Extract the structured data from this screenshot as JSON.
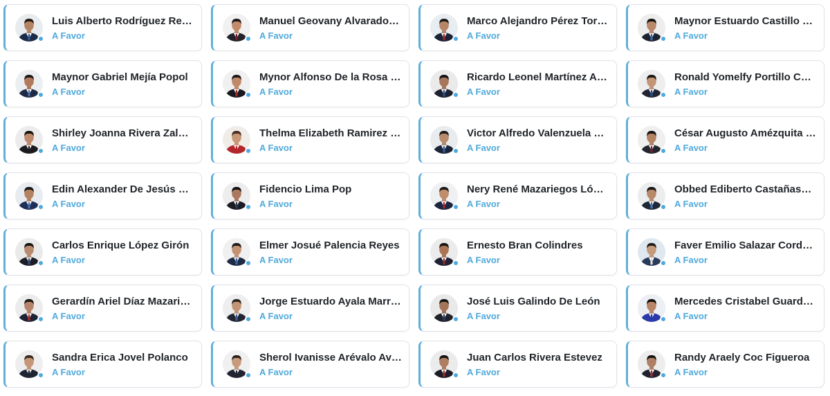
{
  "colors": {
    "accent": "#5fb0d6",
    "vote_text": "#4fa9dc",
    "status_dot": "#4ea9dc",
    "name_text": "#1f2328"
  },
  "cards": [
    {
      "name": "Luis Alberto Rodríguez Reyes",
      "vote": "A Favor",
      "avatar_icon": "person-avatar-icon",
      "suit": "#1d2b46",
      "tie": "#2c5aa0",
      "skin": "#b58463",
      "hair": "#231b16",
      "bg": "#e9ecef"
    },
    {
      "name": "Manuel Geovany Alvarado …",
      "vote": "A Favor",
      "avatar_icon": "person-avatar-icon",
      "suit": "#22232b",
      "tie": "#7a1f27",
      "skin": "#c28c6c",
      "hair": "#1e1a18",
      "bg": "#f1f1f1"
    },
    {
      "name": "Marco Alejandro Pérez Tori…",
      "vote": "A Favor",
      "avatar_icon": "person-avatar-icon",
      "suit": "#1b2436",
      "tie": "#9b2530",
      "skin": "#b78667",
      "hair": "#1c1a19",
      "bg": "#e8edf2"
    },
    {
      "name": "Maynor Estuardo Castillo y …",
      "vote": "A Favor",
      "avatar_icon": "person-avatar-icon",
      "suit": "#1e2330",
      "tie": "#3b6ea8",
      "skin": "#b9886a",
      "hair": "#151312",
      "bg": "#ededed"
    },
    {
      "name": "Maynor Gabriel Mejía Popol",
      "vote": "A Favor",
      "avatar_icon": "person-avatar-icon",
      "suit": "#1e2a44",
      "tie": "#4a6fa5",
      "skin": "#b07a5b",
      "hair": "#201a16",
      "bg": "#eceff2"
    },
    {
      "name": "Mynor Alfonso De la Rosa …",
      "vote": "A Favor",
      "avatar_icon": "person-avatar-icon",
      "suit": "#18191f",
      "tie": "#a02a2a",
      "skin": "#c08a6a",
      "hair": "#1b1817",
      "bg": "#f0f0f0"
    },
    {
      "name": "Ricardo Leonel Martínez Al…",
      "vote": "A Favor",
      "avatar_icon": "person-avatar-icon",
      "suit": "#1d2230",
      "tie": "#2d4f86",
      "skin": "#a8765a",
      "hair": "#141212",
      "bg": "#eaeaea"
    },
    {
      "name": "Ronald Yomelfy Portillo Cor…",
      "vote": "A Favor",
      "avatar_icon": "person-avatar-icon",
      "suit": "#202534",
      "tie": "#274f8c",
      "skin": "#c39475",
      "hair": "#1a1715",
      "bg": "#eeeeee"
    },
    {
      "name": "Shirley Joanna Rivera Zald…",
      "vote": "A Favor",
      "avatar_icon": "person-avatar-icon",
      "suit": "#1a1a1f",
      "tie": "#1a1a1f",
      "skin": "#bf8a6c",
      "hair": "#17120f",
      "bg": "#ececec"
    },
    {
      "name": "Thelma Elizabeth Ramirez …",
      "vote": "A Favor",
      "avatar_icon": "person-avatar-icon",
      "suit": "#b3262c",
      "tie": "#b3262c",
      "skin": "#c99676",
      "hair": "#4a2f22",
      "bg": "#f0ede9"
    },
    {
      "name": "Victor Alfredo Valenzuela …",
      "vote": "A Favor",
      "avatar_icon": "person-avatar-icon",
      "suit": "#1c2538",
      "tie": "#305b99",
      "skin": "#b98b6d",
      "hair": "#1f1b18",
      "bg": "#e9ecef"
    },
    {
      "name": "César Augusto Amézquita …",
      "vote": "A Favor",
      "avatar_icon": "person-avatar-icon",
      "suit": "#22252e",
      "tie": "#7a2330",
      "skin": "#b38363",
      "hair": "#161413",
      "bg": "#efefef"
    },
    {
      "name": "Edin Alexander De Jesús M…",
      "vote": "A Favor",
      "avatar_icon": "person-avatar-icon",
      "suit": "#1f2f55",
      "tie": "#4370b4",
      "skin": "#b5825f",
      "hair": "#1a1715",
      "bg": "#e8ecf1"
    },
    {
      "name": "Fidencio Lima Pop",
      "vote": "A Favor",
      "avatar_icon": "person-avatar-icon",
      "suit": "#1b1d24",
      "tie": "#2f3a55",
      "skin": "#ab7a5e",
      "hair": "#121111",
      "bg": "#ededed"
    },
    {
      "name": "Nery René Mazariegos López",
      "vote": "A Favor",
      "avatar_icon": "person-avatar-icon",
      "suit": "#1b2540",
      "tie": "#a3242c",
      "skin": "#c08c6b",
      "hair": "#1c1917",
      "bg": "#eef0f2"
    },
    {
      "name": "Obbed Ediberto Castañasa …",
      "vote": "A Favor",
      "avatar_icon": "person-avatar-icon",
      "suit": "#1d2738",
      "tie": "#4672b3",
      "skin": "#b8896b",
      "hair": "#1a1716",
      "bg": "#ecedef"
    },
    {
      "name": "Carlos Enrique López Girón",
      "vote": "A Favor",
      "avatar_icon": "person-avatar-icon",
      "suit": "#1c1e25",
      "tie": "#2e4d7d",
      "skin": "#b88b6e",
      "hair": "#161413",
      "bg": "#eaeaea"
    },
    {
      "name": "Elmer Josué Palencia Reyes",
      "vote": "A Favor",
      "avatar_icon": "person-avatar-icon",
      "suit": "#1f2a44",
      "tie": "#3c66a3",
      "skin": "#c29272",
      "hair": "#1d1a18",
      "bg": "#f0f0f0"
    },
    {
      "name": "Ernesto Bran Colindres",
      "vote": "A Favor",
      "avatar_icon": "person-avatar-icon",
      "suit": "#1e2232",
      "tie": "#8c2a2e",
      "skin": "#aa7455",
      "hair": "#181513",
      "bg": "#ebebeb"
    },
    {
      "name": "Faver Emilio Salazar Cordero",
      "vote": "A Favor",
      "avatar_icon": "person-avatar-icon",
      "suit": "#2a3b5a",
      "tie": "#d9d9d9",
      "skin": "#c79a7b",
      "hair": "#201c1a",
      "bg": "#dfe8ef"
    },
    {
      "name": "Gerardín Ariel Díaz Mazarie…",
      "vote": "A Favor",
      "avatar_icon": "person-avatar-icon",
      "suit": "#1c2334",
      "tie": "#b02a2d",
      "skin": "#b5846a",
      "hair": "#1b1816",
      "bg": "#ececec"
    },
    {
      "name": "Jorge Estuardo Ayala Marr…",
      "vote": "A Favor",
      "avatar_icon": "person-avatar-icon",
      "suit": "#232632",
      "tie": "#3e5f93",
      "skin": "#c49575",
      "hair": "#2a2420",
      "bg": "#eeeeee"
    },
    {
      "name": "José Luis Galindo De León",
      "vote": "A Favor",
      "avatar_icon": "person-avatar-icon",
      "suit": "#1f2229",
      "tie": "#2b3c61",
      "skin": "#a5755a",
      "hair": "#141313",
      "bg": "#e9e9e9"
    },
    {
      "name": "Mercedes Cristabel Guarda…",
      "vote": "A Favor",
      "avatar_icon": "person-avatar-icon",
      "suit": "#2a3aa8",
      "tie": "#2a3aa8",
      "skin": "#b98566",
      "hair": "#141110",
      "bg": "#eceff3"
    },
    {
      "name": "Sandra Erica Jovel Polanco",
      "vote": "A Favor",
      "avatar_icon": "person-avatar-icon",
      "suit": "#1f2433",
      "tie": "#1f2433",
      "skin": "#c59677",
      "hair": "#3a2a20",
      "bg": "#eeeeee"
    },
    {
      "name": "Sherol Ivanisse Arévalo Avila",
      "vote": "A Favor",
      "avatar_icon": "person-avatar-icon",
      "suit": "#222331",
      "tie": "#222331",
      "skin": "#c79a7c",
      "hair": "#2b201b",
      "bg": "#f0f0f0"
    },
    {
      "name": "Juan Carlos Rivera Estevez",
      "vote": "A Favor",
      "avatar_icon": "person-avatar-icon",
      "suit": "#1b1e28",
      "tie": "#a0262c",
      "skin": "#b07e61",
      "hair": "#151312",
      "bg": "#ebebeb"
    },
    {
      "name": "Randy Araely Coc Figueroa",
      "vote": "A Favor",
      "avatar_icon": "person-avatar-icon",
      "suit": "#1e2230",
      "tie": "#a32a30",
      "skin": "#b08064",
      "hair": "#161412",
      "bg": "#ededed"
    }
  ]
}
